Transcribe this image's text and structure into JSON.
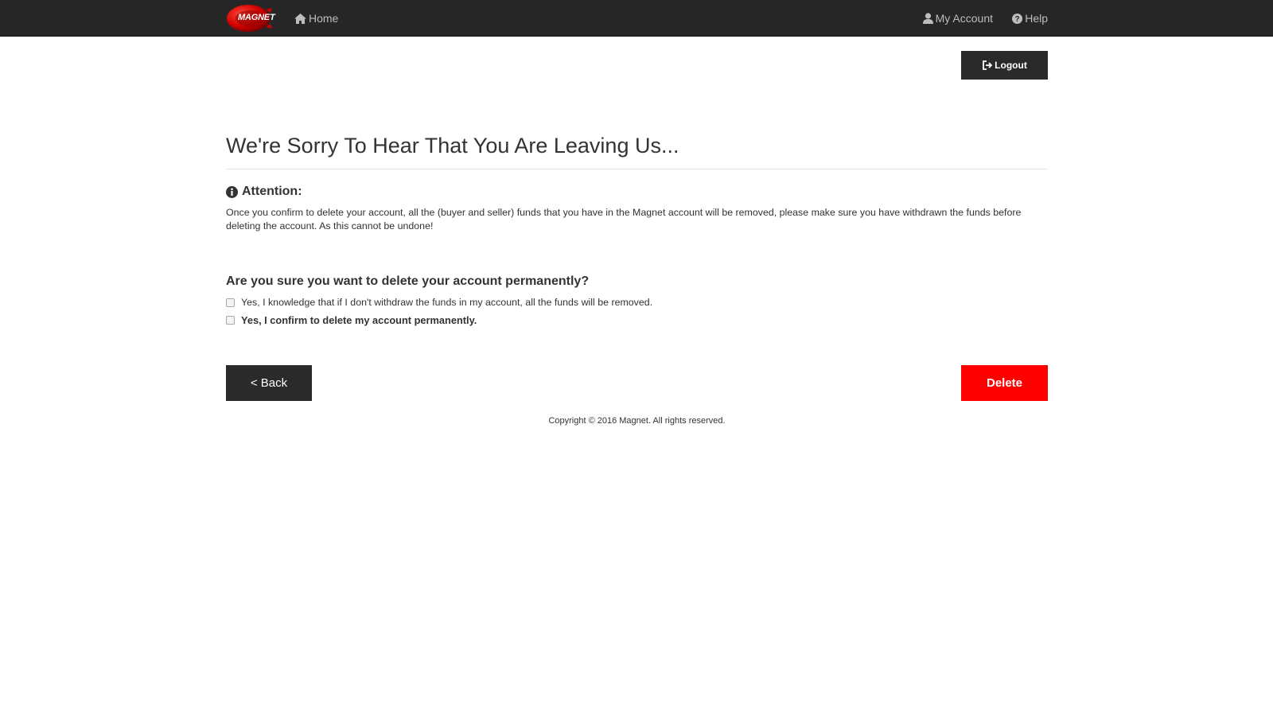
{
  "header": {
    "logo_text": "MAGNET",
    "home_label": "Home",
    "my_account_label": "My Account",
    "help_label": "Help",
    "background_color": "#262626"
  },
  "logout": {
    "label": "Logout"
  },
  "main": {
    "title": "We're Sorry To Hear That You Are Leaving Us...",
    "attention": {
      "heading": "Attention:",
      "text": "Once you confirm to delete your account, all the (buyer and seller) funds that you have in the Magnet account will be removed, please make sure you have withdrawn the funds before deleting the account. As this cannot be undone!"
    },
    "question": "Are you sure you want to delete your account permanently?",
    "checkboxes": [
      {
        "label": "Yes, I knowledge that if I don't withdraw the funds in my account, all the funds will be removed.",
        "checked": false
      },
      {
        "label": "Yes, I confirm to delete my account permanently.",
        "checked": false
      }
    ],
    "back_label": "< Back",
    "delete_label": "Delete"
  },
  "footer": {
    "copyright": "Copyright © 2016 Magnet. All rights reserved."
  },
  "colors": {
    "accent_red": "#ff0000",
    "button_dark": "#2a2a2a",
    "text": "#333333"
  },
  "icons": {
    "logo": "magnet-logo",
    "home": "home-icon",
    "account": "user-icon",
    "help": "question-circle-icon",
    "logout": "sign-out-icon",
    "attention": "info-circle-icon"
  }
}
